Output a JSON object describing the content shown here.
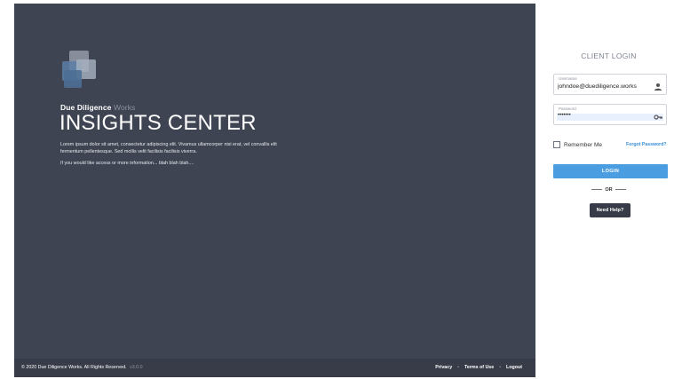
{
  "brand": {
    "name_bold": "Due Diligence",
    "name_light": "Works"
  },
  "hero": {
    "title": "INSIGHTS CENTER",
    "description": "Lorem ipsum dolor sit amet, consectetur adipiscing elit. Vivamus ullamcorper nisi erat, vel convallis elit fermentum pellentesque. Sed mollis velit facilisis facilisis viverra.",
    "access_text": "If you would like access or more information... blah blah blah...."
  },
  "footer": {
    "copyright": "© 2020 Due Diligence Works. All Rights Reserved.",
    "version": "v3.0.0",
    "links": {
      "privacy": "Privacy",
      "terms": "Terms of Use",
      "logout": "Logout"
    }
  },
  "login": {
    "title": "CLIENT LOGIN",
    "username_label": "Username",
    "username_value": "johndoe@duediligence.works",
    "password_label": "Password",
    "password_value": "•••••••",
    "remember_label": "Remember Me",
    "forgot_label": "Forgot Password?",
    "login_button": "LOGIN",
    "or_text": "OR",
    "help_button": "Need Help?"
  },
  "icons": {
    "user": "user-icon",
    "key": "key-icon",
    "logo": "logo-icon"
  },
  "colors": {
    "panel": "#3f4452",
    "accent": "#4a9de0",
    "dark_button": "#363b47"
  }
}
